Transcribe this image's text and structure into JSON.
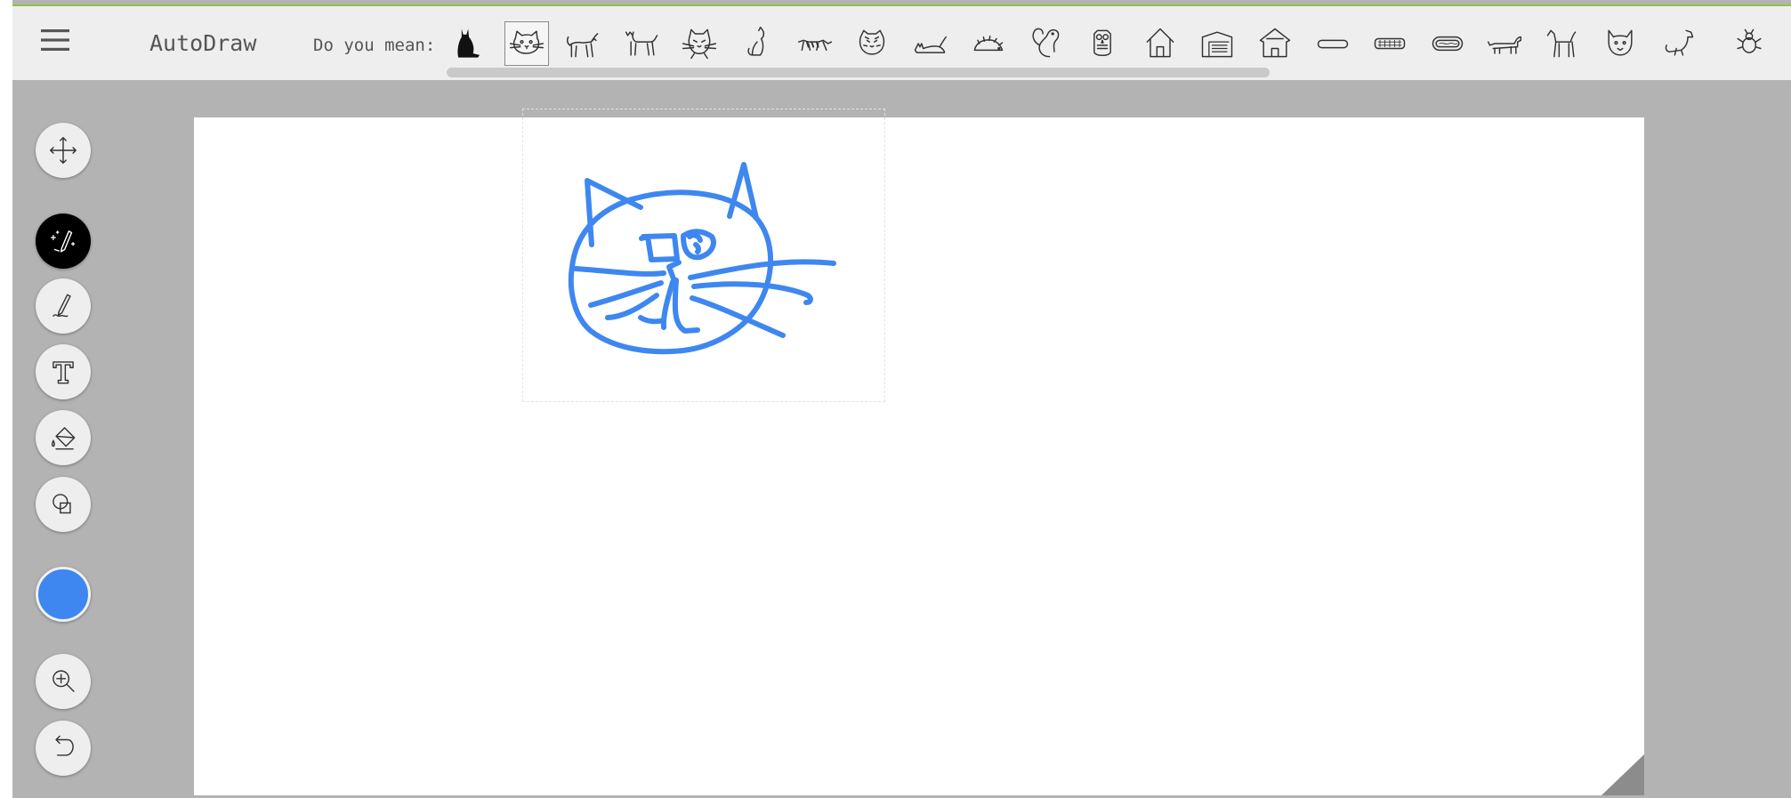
{
  "app": {
    "title": "AutoDraw"
  },
  "suggestions": {
    "label": "Do you mean:",
    "items": [
      {
        "icon": "cat-silhouette-icon",
        "selected": false
      },
      {
        "icon": "cat-face-icon",
        "selected": true
      },
      {
        "icon": "cat-walking-icon",
        "selected": false
      },
      {
        "icon": "cat-standing-icon",
        "selected": false
      },
      {
        "icon": "cat-whiskers-face-icon",
        "selected": false
      },
      {
        "icon": "cat-sitting-icon",
        "selected": false
      },
      {
        "icon": "tiger-running-icon",
        "selected": false
      },
      {
        "icon": "tiger-face-icon",
        "selected": false
      },
      {
        "icon": "cat-lying-icon",
        "selected": false
      },
      {
        "icon": "hedgehog-icon",
        "selected": false
      },
      {
        "icon": "squirrel-icon",
        "selected": false
      },
      {
        "icon": "owl-icon",
        "selected": false
      },
      {
        "icon": "house-icon",
        "selected": false
      },
      {
        "icon": "barn-icon",
        "selected": false
      },
      {
        "icon": "house-outline-icon",
        "selected": false
      },
      {
        "icon": "hotdog-plain-icon",
        "selected": false
      },
      {
        "icon": "hotdog-icon",
        "selected": false
      },
      {
        "icon": "hotdog-bun-icon",
        "selected": false
      },
      {
        "icon": "dachshund-icon",
        "selected": false
      },
      {
        "icon": "dog-standing-icon",
        "selected": false
      },
      {
        "icon": "dog-face-icon",
        "selected": false
      },
      {
        "icon": "dog-sitting-icon",
        "selected": false
      },
      {
        "icon": "bug-icon",
        "selected": false
      }
    ]
  },
  "tools": [
    {
      "name": "move-tool",
      "icon": "move-arrows-icon",
      "active": false
    },
    {
      "name": "autodraw-tool",
      "icon": "magic-pencil-icon",
      "active": true
    },
    {
      "name": "draw-tool",
      "icon": "pencil-icon",
      "active": false
    },
    {
      "name": "text-tool",
      "icon": "text-t-icon",
      "active": false
    },
    {
      "name": "fill-tool",
      "icon": "paint-bucket-icon",
      "active": false
    },
    {
      "name": "shape-tool",
      "icon": "shapes-icon",
      "active": false
    },
    {
      "name": "zoom-tool",
      "icon": "zoom-in-icon",
      "active": false
    },
    {
      "name": "undo-tool",
      "icon": "undo-icon",
      "active": false
    }
  ],
  "colors": {
    "selected": "#3e87f0",
    "toolbar_bg": "#eeeeee",
    "workspace_bg": "#b3b3b3",
    "accent_line": "#8bc34a"
  },
  "canvas": {
    "drawing": "hand-drawn cat face sketch in blue"
  }
}
